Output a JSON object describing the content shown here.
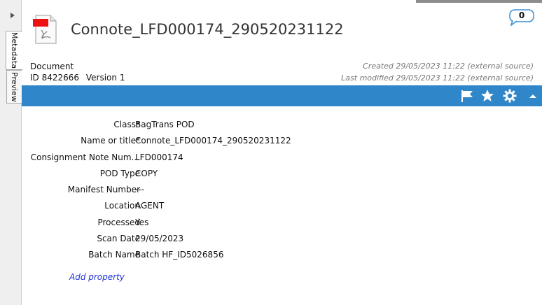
{
  "header": {
    "title": "Connote_LFD000174_290520231122",
    "comment_count": "0",
    "doc_type": "Document",
    "doc_id": "ID 8422666",
    "version": "Version 1",
    "created": "Created 29/05/2023 11:22 (external source)",
    "modified": "Last modified 29/05/2023 11:22 (external source)"
  },
  "sidebar": {
    "tabs": [
      {
        "label": "Metadata",
        "active": true
      },
      {
        "label": "Preview",
        "active": false
      }
    ]
  },
  "toolbar": {
    "icons": [
      "flag-icon",
      "star-icon",
      "gear-icon",
      "collapse-up-icon"
    ],
    "color": "#2f86c9"
  },
  "properties": [
    {
      "label": "Class*",
      "value": "BagTrans POD"
    },
    {
      "label": "Name or title*",
      "value": "Connote_LFD000174_290520231122"
    },
    {
      "label": "Consignment Note Num...",
      "value": "LFD000174"
    },
    {
      "label": "POD Type",
      "value": "COPY"
    },
    {
      "label": "Manifest Number",
      "value": "---"
    },
    {
      "label": "Location",
      "value": "AGENT"
    },
    {
      "label": "Processed",
      "value": "Yes"
    },
    {
      "label": "Scan Date",
      "value": "29/05/2023"
    },
    {
      "label": "Batch Name",
      "value": "Batch HF_ID5026856"
    }
  ],
  "add_property_label": "Add property"
}
